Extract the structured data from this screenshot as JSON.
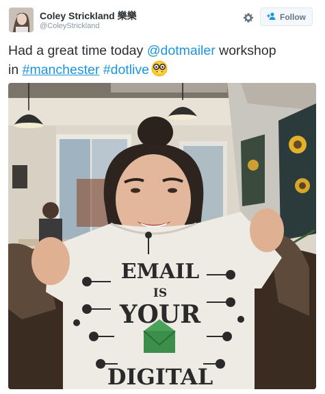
{
  "author": {
    "name": "Coley Strickland 樂樂",
    "handle": "@ColeyStrickland"
  },
  "actions": {
    "follow_label": "Follow",
    "settings_icon": "gear-icon",
    "follow_icon": "add-user-icon"
  },
  "tweet": {
    "text_before": "Had a great time today ",
    "mention": "@dotmailer",
    "text_middle": " workshop",
    "text_line2_prefix": "in ",
    "hashtag1": "#manchester",
    "hashtag2": "#dotlive",
    "emoji": "nerd-face-emoji"
  },
  "photo": {
    "shirt_lines": [
      "EMAIL",
      "IS",
      "YOUR",
      "DIGITAL"
    ]
  },
  "colors": {
    "link": "#1b95e0",
    "text": "#292f33",
    "muted": "#8899a6",
    "follow_border": "#e1e8ed"
  }
}
